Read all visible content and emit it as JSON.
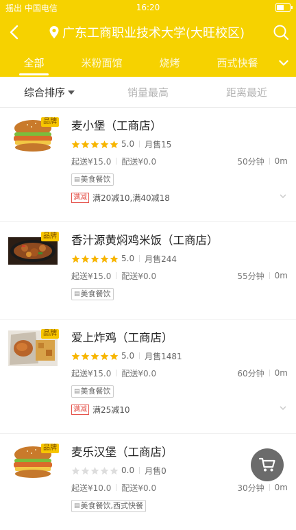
{
  "status_bar": {
    "carrier": "摇出 中国电信",
    "time": "16:20"
  },
  "header": {
    "title": "广东工商职业技术大学(大旺校区)"
  },
  "categories": [
    "全部",
    "米粉面馆",
    "烧烤",
    "西式快餐"
  ],
  "sort_tabs": [
    "综合排序",
    "销量最高",
    "距离最近"
  ],
  "shops": [
    {
      "name": "麦小堡（工商店）",
      "brand": "品牌",
      "rating": 5,
      "rating_text": "5.0",
      "monthly_sales": "月售15",
      "min_order": "起送¥15.0",
      "delivery_fee": "配送¥0.0",
      "time": "50分钟",
      "distance": "0m",
      "tag": "美食餐饮",
      "promo_badge": "满减",
      "promo": "满20减10,满40减18",
      "image": "burger"
    },
    {
      "name": "香汁源黄焖鸡米饭（工商店）",
      "brand": "品牌",
      "rating": 5,
      "rating_text": "5.0",
      "monthly_sales": "月售244",
      "min_order": "起送¥15.0",
      "delivery_fee": "配送¥0.0",
      "time": "55分钟",
      "distance": "0m",
      "tag": "美食餐饮",
      "image": "braised-chicken"
    },
    {
      "name": "爱上炸鸡（工商店）",
      "brand": "品牌",
      "rating": 5,
      "rating_text": "5.0",
      "monthly_sales": "月售1481",
      "min_order": "起送¥15.0",
      "delivery_fee": "配送¥0.0",
      "time": "60分钟",
      "distance": "0m",
      "tag": "美食餐饮",
      "promo_badge": "满减",
      "promo": "满25减10",
      "image": "fried-chicken"
    },
    {
      "name": "麦乐汉堡（工商店）",
      "brand": "品牌",
      "rating": 0,
      "rating_text": "0.0",
      "monthly_sales": "月售0",
      "min_order": "起送¥10.0",
      "delivery_fee": "配送¥0.0",
      "time": "30分钟",
      "distance": "0m",
      "tag": "美食餐饮,西式快餐",
      "image": "burger"
    }
  ],
  "colors": {
    "brand_yellow": "#f6d200",
    "star": "#f7b500",
    "star_empty": "#dddddd",
    "promo_red": "#e5534b"
  },
  "icons": {
    "back": "back-arrow-icon",
    "location": "location-pin-icon",
    "search": "search-icon",
    "more": "chevron-down-icon",
    "cart": "cart-icon"
  }
}
